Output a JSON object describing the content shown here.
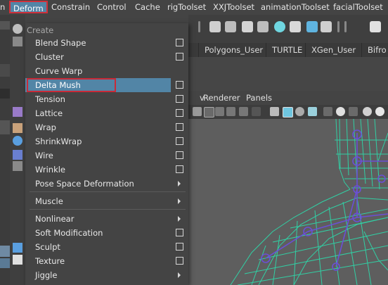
{
  "menubar": {
    "items": [
      "n",
      "Deform",
      "Constrain",
      "Control",
      "Cache",
      "rigToolset",
      "XXJToolset",
      "animationToolset",
      "facialToolset"
    ]
  },
  "shelf": {
    "tabs": [
      "Polygons_User",
      "TURTLE",
      "XGen_User",
      "Bifro"
    ]
  },
  "viewport_menu": {
    "items": [
      "v",
      "Renderer",
      "Panels"
    ]
  },
  "deform_menu": {
    "section_label": "Create",
    "items": [
      {
        "label": "Blend Shape",
        "suffix": "option-box"
      },
      {
        "label": "Cluster",
        "suffix": "option-box"
      },
      {
        "label": "Curve Warp",
        "suffix": "none"
      },
      {
        "label": "Delta Mush",
        "suffix": "option-box",
        "highlighted": true
      },
      {
        "label": "Tension",
        "suffix": "option-box"
      },
      {
        "label": "Lattice",
        "suffix": "option-box"
      },
      {
        "label": "Wrap",
        "suffix": "option-box"
      },
      {
        "label": "ShrinkWrap",
        "suffix": "option-box"
      },
      {
        "label": "Wire",
        "suffix": "option-box"
      },
      {
        "label": "Wrinkle",
        "suffix": "option-box"
      },
      {
        "label": "Pose Space Deformation",
        "suffix": "submenu"
      },
      {
        "label": "Muscle",
        "suffix": "submenu"
      },
      {
        "label": "Nonlinear",
        "suffix": "submenu"
      },
      {
        "label": "Soft Modification",
        "suffix": "option-box"
      },
      {
        "label": "Sculpt",
        "suffix": "option-box"
      },
      {
        "label": "Texture",
        "suffix": "option-box"
      },
      {
        "label": "Jiggle",
        "suffix": "submenu"
      }
    ]
  },
  "colors": {
    "highlight": "#5285a6",
    "annotation_red": "#c92a37",
    "mesh_wire": "#2fd6a8",
    "skeleton": "#6b4fd6"
  }
}
